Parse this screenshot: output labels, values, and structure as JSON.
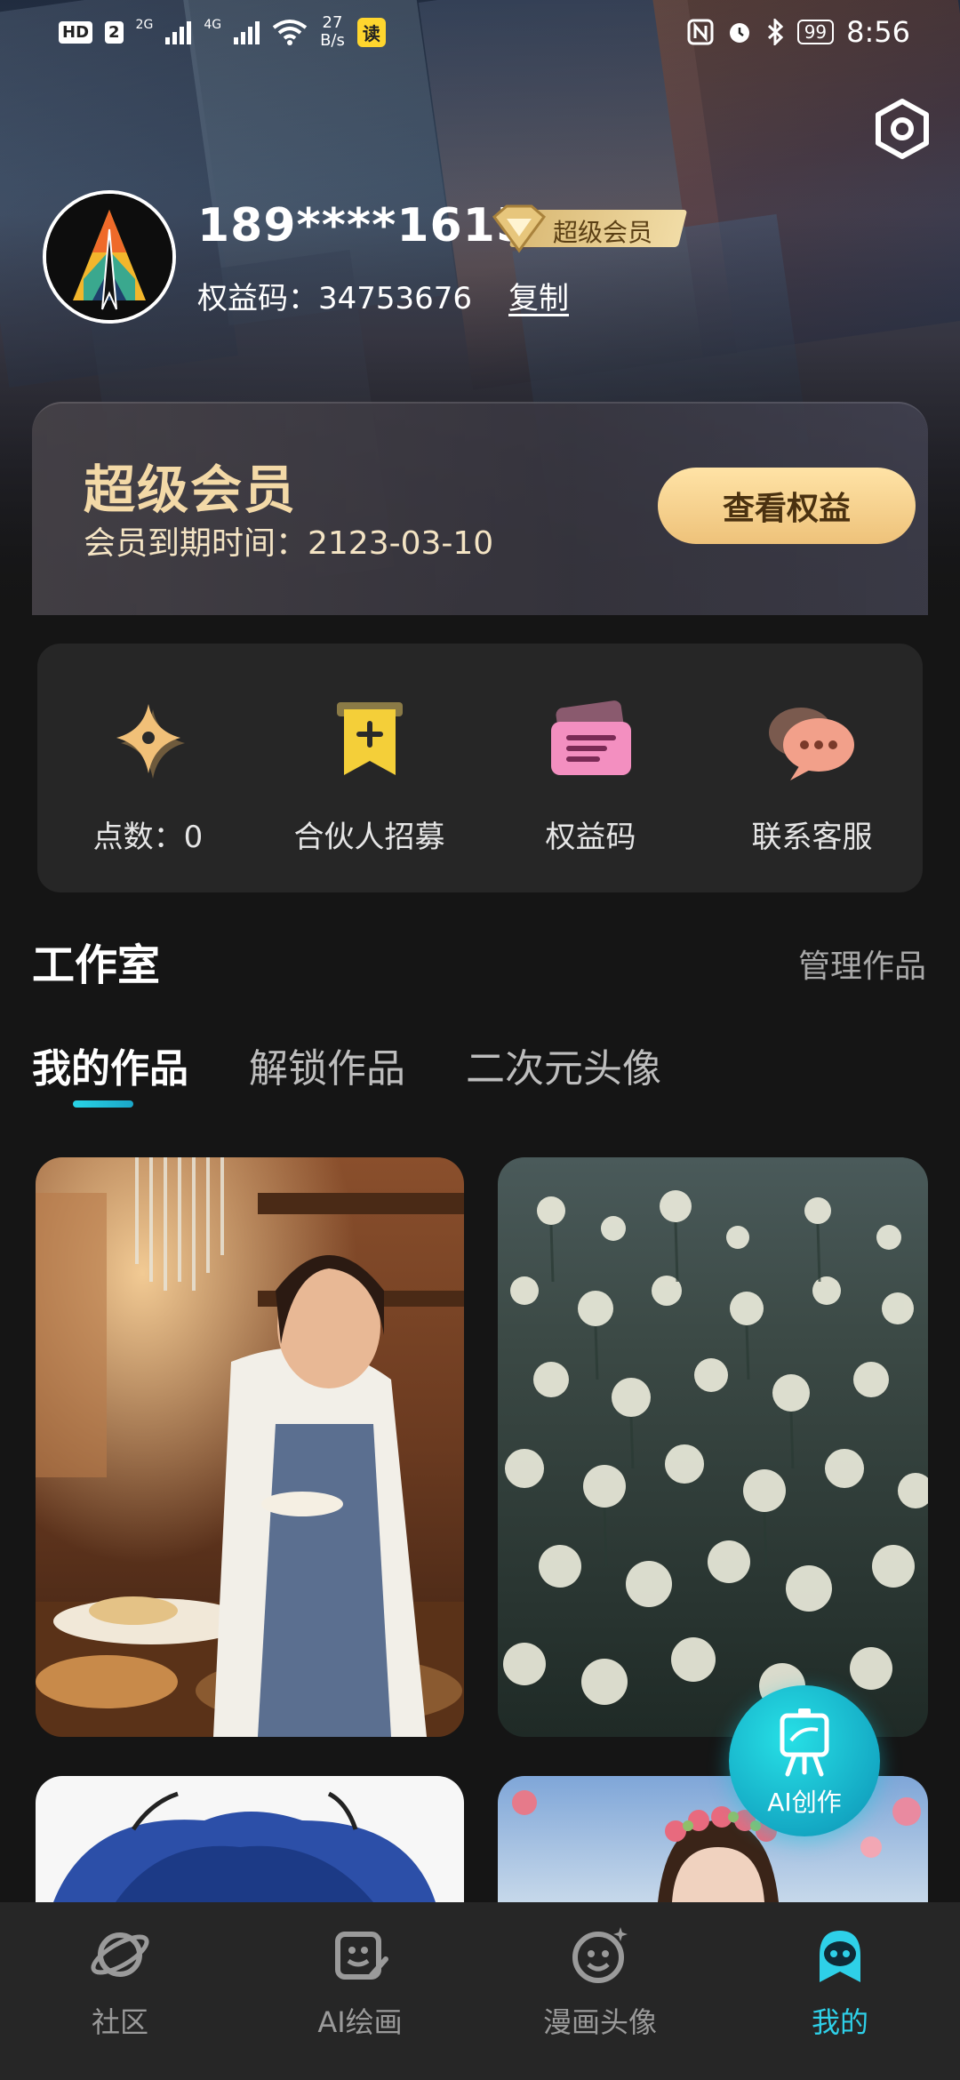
{
  "status_bar": {
    "hd_label": "HD",
    "sim_label": "2",
    "net1": "2G",
    "net2": "4G",
    "speed_value": "27",
    "speed_unit": "B/s",
    "read_badge": "读",
    "battery": "99",
    "time": "8:56"
  },
  "profile": {
    "phone": "189****1615",
    "vip_badge": "超级会员",
    "code_label": "权益码：34753676",
    "copy_label": "复制"
  },
  "vip_card": {
    "title": "超级会员",
    "expire": "会员到期时间：2123-03-10",
    "button": "查看权益"
  },
  "quick_actions": [
    {
      "label": "点数：0",
      "icon": "sparkle-icon"
    },
    {
      "label": "合伙人招募",
      "icon": "bookmark-plus-icon"
    },
    {
      "label": "权益码",
      "icon": "ticket-icon"
    },
    {
      "label": "联系客服",
      "icon": "chat-bubbles-icon"
    }
  ],
  "studio": {
    "title": "工作室",
    "manage": "管理作品",
    "tabs": [
      "我的作品",
      "解锁作品",
      "二次元头像"
    ]
  },
  "fab": {
    "label": "AI创作"
  },
  "bottom_nav": [
    {
      "label": "社区",
      "icon": "planet-icon"
    },
    {
      "label": "AI绘画",
      "icon": "paint-board-icon"
    },
    {
      "label": "漫画头像",
      "icon": "smiley-icon"
    },
    {
      "label": "我的",
      "icon": "profile-robot-icon"
    }
  ],
  "colors": {
    "accent": "#2ed0e8",
    "gold": "#f3d9a7",
    "background": "#151515",
    "panel": "#262626"
  }
}
